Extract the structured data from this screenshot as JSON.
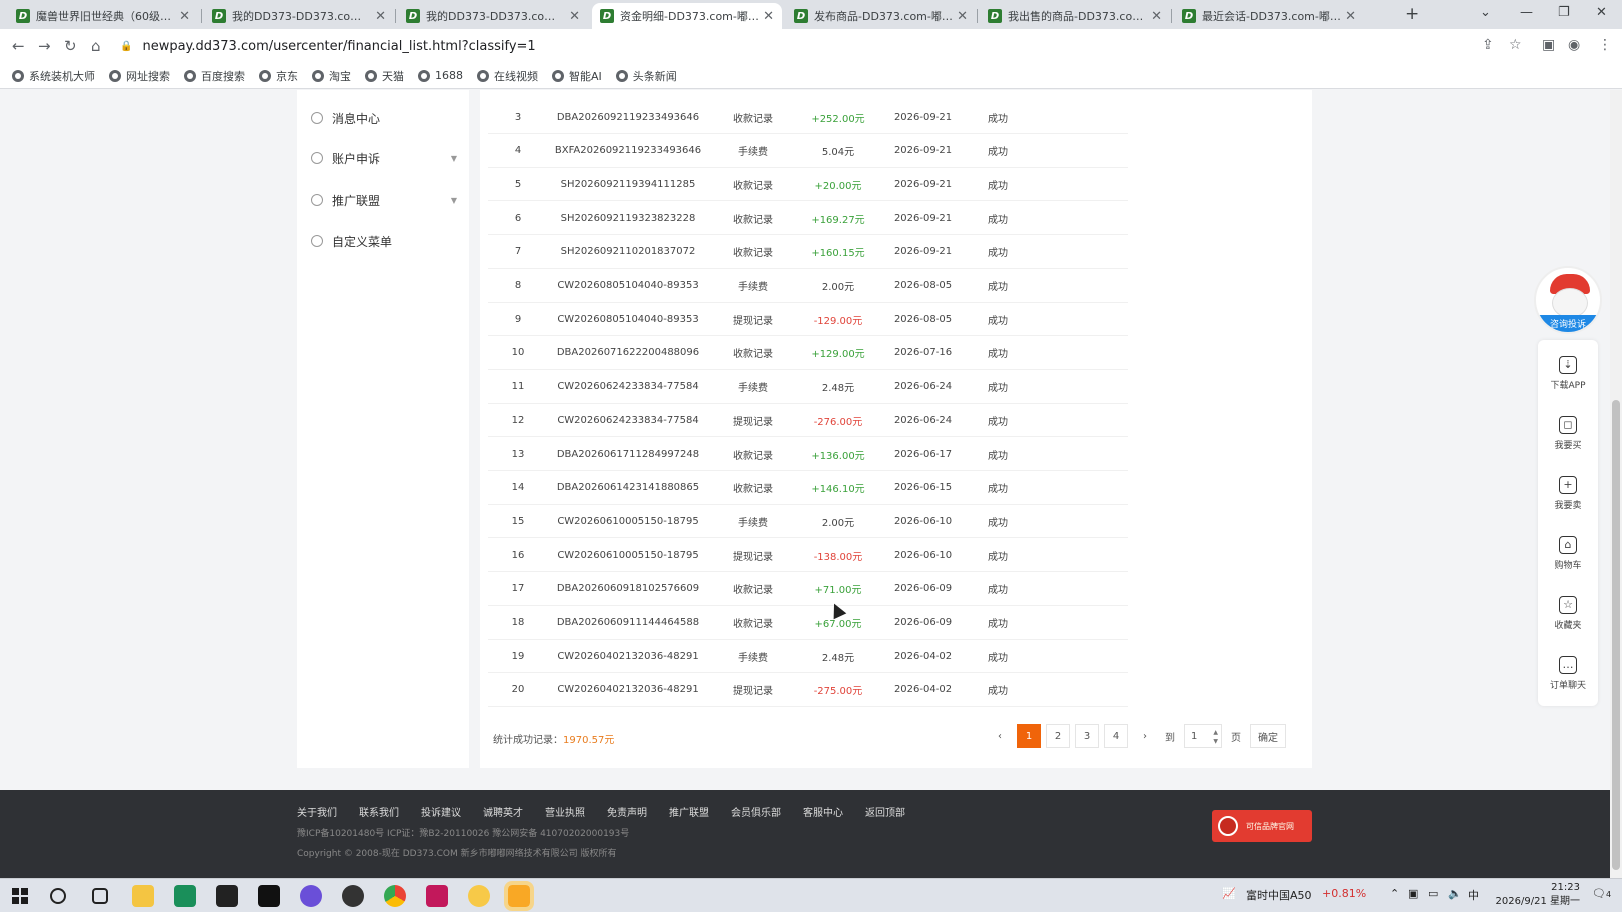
{
  "browser": {
    "tabs": [
      {
        "title": "魔兽世界旧世经典（60级）游…",
        "active": false
      },
      {
        "title": "我的DD373-DD373.com-嘟嘟…",
        "active": false
      },
      {
        "title": "我的DD373-DD373.com-嘟嘟…",
        "active": false
      },
      {
        "title": "资金明细-DD373.com-嘟嘟网…",
        "active": true
      },
      {
        "title": "发布商品-DD373.com-嘟嘟网…",
        "active": false
      },
      {
        "title": "我出售的商品-DD373.com-嘟…",
        "active": false
      },
      {
        "title": "最近会话-DD373.com-嘟嘟网…",
        "active": false
      }
    ],
    "favicon_letter": "D",
    "url": "newpay.dd373.com/usercenter/financial_list.html?classify=1",
    "bookmarks": [
      "系统装机大师",
      "网址搜索",
      "百度搜索",
      "京东",
      "淘宝",
      "天猫",
      "1688",
      "在线视频",
      "智能AI",
      "头条新闻"
    ]
  },
  "sidebar": {
    "items": [
      {
        "label": "消息中心",
        "icon": "mail-icon",
        "expandable": false
      },
      {
        "label": "账户申诉",
        "icon": "info-icon",
        "expandable": true
      },
      {
        "label": "推广联盟",
        "icon": "user-icon",
        "expandable": true
      },
      {
        "label": "自定义菜单",
        "icon": "gear-icon",
        "expandable": false
      }
    ]
  },
  "table": {
    "rows": [
      {
        "no": "3",
        "order": "DBA202609211923349​3646",
        "type": "收款记录",
        "amount": "+252.00元",
        "kind": "in",
        "date": "2026-09-21",
        "status": "成功"
      },
      {
        "no": "4",
        "order": "BXFA202609211923349​3646",
        "type": "手续费",
        "amount": "5.04元",
        "kind": "fee",
        "date": "2026-09-21",
        "status": "成功"
      },
      {
        "no": "5",
        "order": "SH2026092119394111285",
        "type": "收款记录",
        "amount": "+20.00元",
        "kind": "in",
        "date": "2026-09-21",
        "status": "成功"
      },
      {
        "no": "6",
        "order": "SH2026092119323823228",
        "type": "收款记录",
        "amount": "+169.27元",
        "kind": "in",
        "date": "2026-09-21",
        "status": "成功"
      },
      {
        "no": "7",
        "order": "SH2026092110201837072",
        "type": "收款记录",
        "amount": "+160.15元",
        "kind": "in",
        "date": "2026-09-21",
        "status": "成功"
      },
      {
        "no": "8",
        "order": "CW20260805104040-89353",
        "type": "手续费",
        "amount": "2.00元",
        "kind": "fee",
        "date": "2026-08-05",
        "status": "成功"
      },
      {
        "no": "9",
        "order": "CW20260805104040-89353",
        "type": "提现记录",
        "amount": "-129.00元",
        "kind": "out",
        "date": "2026-08-05",
        "status": "成功"
      },
      {
        "no": "10",
        "order": "DBA2026071622200488096",
        "type": "收款记录",
        "amount": "+129.00元",
        "kind": "in",
        "date": "2026-07-16",
        "status": "成功"
      },
      {
        "no": "11",
        "order": "CW20260624233834-77584",
        "type": "手续费",
        "amount": "2.48元",
        "kind": "fee",
        "date": "2026-06-24",
        "status": "成功"
      },
      {
        "no": "12",
        "order": "CW20260624233834-77584",
        "type": "提现记录",
        "amount": "-276.00元",
        "kind": "out",
        "date": "2026-06-24",
        "status": "成功"
      },
      {
        "no": "13",
        "order": "DBA2026061711284997248",
        "type": "收款记录",
        "amount": "+136.00元",
        "kind": "in",
        "date": "2026-06-17",
        "status": "成功"
      },
      {
        "no": "14",
        "order": "DBA2026061423141880865",
        "type": "收款记录",
        "amount": "+146.10元",
        "kind": "in",
        "date": "2026-06-15",
        "status": "成功"
      },
      {
        "no": "15",
        "order": "CW20260610005150-18795",
        "type": "手续费",
        "amount": "2.00元",
        "kind": "fee",
        "date": "2026-06-10",
        "status": "成功"
      },
      {
        "no": "16",
        "order": "CW20260610005150-18795",
        "type": "提现记录",
        "amount": "-138.00元",
        "kind": "out",
        "date": "2026-06-10",
        "status": "成功"
      },
      {
        "no": "17",
        "order": "DBA2026060918102576609",
        "type": "收款记录",
        "amount": "+71.00元",
        "kind": "in",
        "date": "2026-06-09",
        "status": "成功"
      },
      {
        "no": "18",
        "order": "DBA2026060911144464588",
        "type": "收款记录",
        "amount": "+67.00元",
        "kind": "in",
        "date": "2026-06-09",
        "status": "成功"
      },
      {
        "no": "19",
        "order": "CW20260402132036-48291",
        "type": "手续费",
        "amount": "2.48元",
        "kind": "fee",
        "date": "2026-04-02",
        "status": "成功"
      },
      {
        "no": "20",
        "order": "CW20260402132036-48291",
        "type": "提现记录",
        "amount": "-275.00元",
        "kind": "out",
        "date": "2026-04-02",
        "status": "成功"
      }
    ],
    "summary_label": "统计成功记录：",
    "summary_value": "1970.57元"
  },
  "pager": {
    "prev": "‹",
    "pages": [
      "1",
      "2",
      "3",
      "4"
    ],
    "current": "1",
    "next": "›",
    "goto_label": "到",
    "goto_value": "1",
    "page_unit": "页",
    "confirm": "确定"
  },
  "footer": {
    "links": [
      "关于我们",
      "联系我们",
      "投诉建议",
      "诚聘英才",
      "营业执照",
      "免责声明",
      "推广联盟",
      "会员俱乐部",
      "客服中心",
      "返回顶部"
    ],
    "line1": "豫ICP备10201480号    ICP证：豫B2-20110026    豫公网安备 41070202000193号",
    "line2": "Copyright © 2008-现在   DD373.COM 新乡市嘟嘟网络技术有限公司   版权所有",
    "badge_text": "可信品牌官网"
  },
  "float_bar": {
    "mascot_label": "咨询投诉",
    "items": [
      {
        "label": "下载APP",
        "icon": "download-icon",
        "glyph": "⇣"
      },
      {
        "label": "我要买",
        "icon": "bag-icon",
        "glyph": "◻"
      },
      {
        "label": "我要卖",
        "icon": "plus-circle-icon",
        "glyph": "+"
      },
      {
        "label": "购物车",
        "icon": "cart-icon",
        "glyph": "⌂"
      },
      {
        "label": "收藏夹",
        "icon": "star-icon",
        "glyph": "☆"
      },
      {
        "label": "订单聊天",
        "icon": "chat-icon",
        "glyph": "…"
      }
    ]
  },
  "taskbar": {
    "stock_name": "富时中国A50",
    "stock_change": "+0.81%",
    "ime": "中",
    "time": "21:23",
    "date": "2026/9/21 星期一",
    "notify_count": "4"
  }
}
